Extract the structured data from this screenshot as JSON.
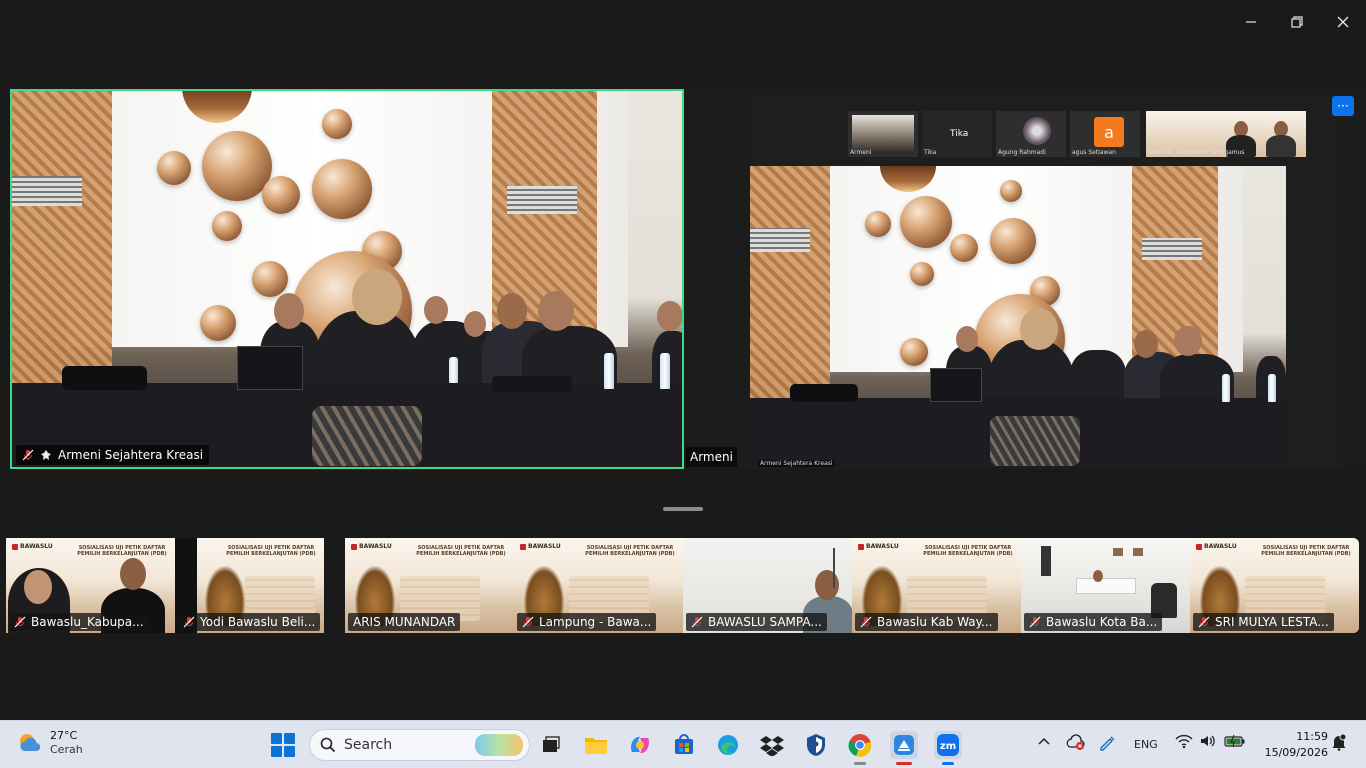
{
  "window": {
    "minimize_icon": "minimize-icon",
    "maximize_icon": "restore-icon",
    "close_icon": "close-icon"
  },
  "main_tiles": {
    "left": {
      "name": "Armeni Sejahtera Kreasi",
      "active_speaker_color": "#3ddc84"
    },
    "right": {
      "name": "Armeni",
      "more_label": "···"
    }
  },
  "shared_screen": {
    "thumbnails": [
      {
        "name": "Armeni"
      },
      {
        "name": "Tika",
        "text": "Tika"
      },
      {
        "name": "Agung Rahmadi"
      },
      {
        "name": "agus Setiawan",
        "avatar_letter": "a",
        "avatar_color": "#f37a1f"
      },
      {
        "name": "Bawaslu_Kabupaten Tanggamus"
      }
    ],
    "main_name": "Armeni Sejahtera Kreasi"
  },
  "participants": [
    {
      "name": "Bawaslu_Kabupa..."
    },
    {
      "name": "Yodi Bawaslu Beli..."
    },
    {
      "name": "ARIS MUNANDAR"
    },
    {
      "name": "Lampung - Bawa..."
    },
    {
      "name": "BAWASLU SAMPA..."
    },
    {
      "name": "Bawaslu Kab Way..."
    },
    {
      "name": "Bawaslu Kota Ba..."
    },
    {
      "name": "SRI MULYA LESTA..."
    }
  ],
  "banner": {
    "brand": "BAWASLU",
    "title": "SOSIALISASI UJI PETIK DAFTAR PEMILIH BERKELANJUTAN (PDB)"
  },
  "taskbar": {
    "weather": {
      "temp": "27°C",
      "condition": "Cerah"
    },
    "search_placeholder": "Search",
    "language": "ENG",
    "time": "11:59",
    "date": "15/09/2026"
  },
  "colors": {
    "zoom_blue": "#0e72ed",
    "muted_red": "#e53935",
    "taskbar": "#dfe4ee"
  }
}
